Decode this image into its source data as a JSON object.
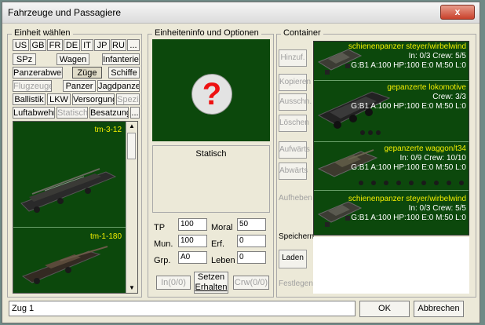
{
  "window": {
    "title": "Fahrzeuge und Passagiere",
    "close_label": "x"
  },
  "left": {
    "group_label": "Einheit wählen",
    "row1": [
      "US",
      "GB",
      "FR",
      "DE",
      "IT",
      "JP",
      "RU",
      "..."
    ],
    "row2": [
      "SPz",
      "Wagen",
      "Infanterie"
    ],
    "row3": [
      "Panzerabwehr",
      "Züge",
      "Schiffe"
    ],
    "row4": [
      "Flugzeuge",
      "Panzer",
      "Jagdpanzer"
    ],
    "row5": [
      "Ballistik",
      "LKW",
      "Versorgung",
      "Spezial"
    ],
    "row6": [
      "Luftabwehr",
      "Statisch",
      "Besatzung",
      "..."
    ],
    "list": [
      {
        "name": "tm-3-12"
      },
      {
        "name": "tm-1-180"
      }
    ]
  },
  "middle": {
    "group_label": "Einheiteninfo und Optionen",
    "status_label": "Statisch",
    "fields": {
      "tp_label": "TP",
      "tp_value": "100",
      "mun_label": "Mun.",
      "mun_value": "100",
      "grp_label": "Grp.",
      "grp_value": "A0",
      "moral_label": "Moral",
      "moral_value": "50",
      "erf_label": "Erf.",
      "erf_value": "0",
      "leben_label": "Leben",
      "leben_value": "0"
    },
    "in_button": "In(0/0)",
    "setzen_button": "Setzen",
    "erhalten_button": "Erhalten",
    "crw_button": "Crw(0/0)"
  },
  "container": {
    "group_label": "Container",
    "buttons": [
      "Hinzuf.",
      "Kopieren",
      "Ausschn.",
      "Löschen",
      "Aufwärts",
      "Abwärts",
      "Aufheben",
      "Speichern",
      "Laden",
      "Festlegen"
    ],
    "items": [
      {
        "name": "schienenpanzer steyer/wirbelwind",
        "line2": "In: 0/3 Crew: 5/5",
        "line3": "G:B1 A:100 HP:100 E:0 M:50 L:0"
      },
      {
        "name": "gepanzerte lokomotive",
        "line2": "Crew: 3/3",
        "line3": "G:B1 A:100 HP:100 E:0 M:50 L:0"
      },
      {
        "name": "gepanzerte waggon/t34",
        "line2": "In: 0/9 Crew: 10/10",
        "line3": "G:B1 A:100 HP:100 E:0 M:50 L:0"
      },
      {
        "name": "schienenpanzer steyer/wirbelwind",
        "line2": "In: 0/3 Crew: 5/5",
        "line3": "G:B1 A:100 HP:100 E:0 M:50 L:0"
      }
    ]
  },
  "bottom": {
    "name_value": "Zug 1",
    "ok_label": "OK",
    "cancel_label": "Abbrechen"
  },
  "colors": {
    "list_bg": "#0c480c",
    "highlight_text": "#f4f000",
    "info_text": "#ffffff"
  }
}
